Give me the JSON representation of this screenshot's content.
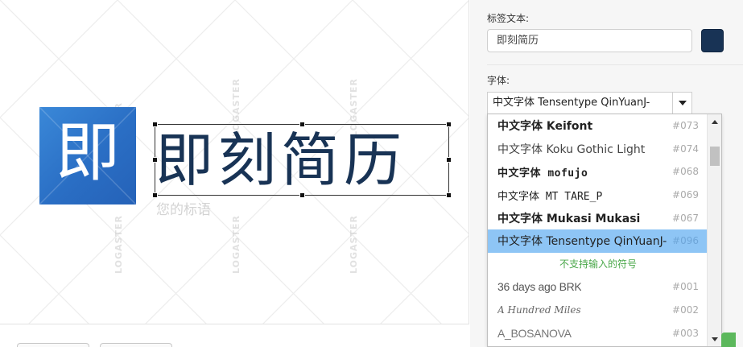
{
  "canvas": {
    "watermark": "LOGASTER",
    "logo_icon_glyph": "即",
    "brand_name": "即刻简历",
    "slogan": "您的标语",
    "text_color": "#183355",
    "icon_color": "#2f78cf"
  },
  "panel": {
    "label_text_title": "标签文本:",
    "label_text_value": "即刻简历",
    "label_color": "#183355",
    "font_title": "字体:",
    "font_selected": "中文字体  Tensentype  QinYuanJ-"
  },
  "font_list": {
    "items": [
      {
        "name": "中文字体 Keifont",
        "num": "#073",
        "style": "bold"
      },
      {
        "name": "中文字体 Koku Gothic Light",
        "num": "#074",
        "style": "light"
      },
      {
        "name": "中文字体 mofujo",
        "num": "#068",
        "style": "pixel"
      },
      {
        "name": "中文字体 MT TARE_P",
        "num": "#069",
        "style": "mono"
      },
      {
        "name": "中文字体 Mukasi Mukasi",
        "num": "#067",
        "style": "bold"
      },
      {
        "name": "中文字体  Tensentype  QinYuanJ-",
        "num": "#096",
        "style": "selected"
      },
      {
        "name": "不支持输入的符号",
        "num": "",
        "style": "notice"
      },
      {
        "name": "36 days ago BRK",
        "num": "#001",
        "style": "condensed"
      },
      {
        "name": "A Hundred Miles",
        "num": "#002",
        "style": "hand"
      },
      {
        "name": "A_BOSANOVA",
        "num": "#003",
        "style": "grey"
      }
    ]
  },
  "colors": {
    "accent_selected": "#8ec5f5",
    "notice_green": "#4aa84a",
    "confirm_green": "#5cb85c"
  }
}
